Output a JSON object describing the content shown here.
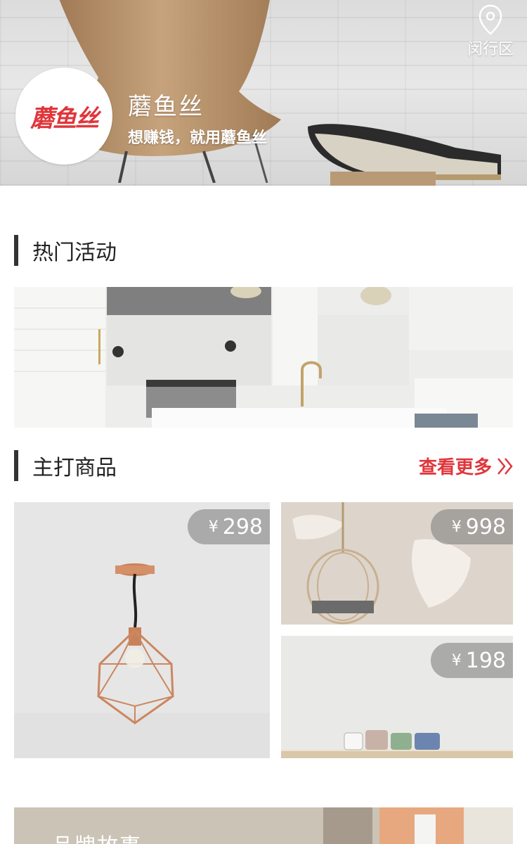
{
  "header": {
    "location": "闵行区",
    "logo_text": "蘑鱼丝",
    "brand_name": "蘑鱼丝",
    "slogan": "想赚钱，就用蘑鱼丝"
  },
  "sections": {
    "hot_activities": "热门活动",
    "featured_products": "主打商品",
    "see_more": "查看更多"
  },
  "products": [
    {
      "currency": "¥",
      "price": "298",
      "image": "copper-pendant-lamp"
    },
    {
      "currency": "¥",
      "price": "998",
      "image": "hanging-rattan-chair"
    },
    {
      "currency": "¥",
      "price": "198",
      "image": "teacups-on-shelf"
    }
  ],
  "brand_story": {
    "title": "品牌故事"
  },
  "colors": {
    "accent": "#e0363b",
    "section_bar": "#333333",
    "price_tag_bg": "#808080"
  }
}
